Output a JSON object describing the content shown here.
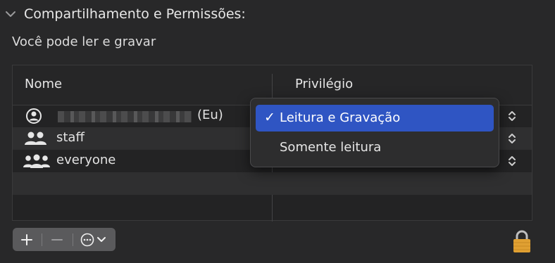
{
  "section": {
    "title": "Compartilhamento e Permissões:",
    "permission_summary": "Você pode ler e gravar"
  },
  "table": {
    "columns": {
      "name": "Nome",
      "privilege": "Privilégio"
    },
    "rows": [
      {
        "name_suffix": "(Eu)",
        "icon": "user-icon",
        "name_redacted": true
      },
      {
        "name": "staff",
        "icon": "group-icon"
      },
      {
        "name": "everyone",
        "icon": "everyone-icon"
      }
    ]
  },
  "privilege_menu": {
    "options": [
      {
        "label": "Leitura e Gravação",
        "checked": true
      },
      {
        "label": "Somente leitura",
        "checked": false
      }
    ],
    "check_glyph": "✓"
  },
  "toolbar": {
    "add_icon": "plus-icon",
    "remove_icon": "minus-icon",
    "actions_icon": "ellipsis-circle-icon"
  },
  "lock": {
    "icon": "lock-icon",
    "state": "unlocked"
  },
  "colors": {
    "accent": "#2f55c3",
    "background": "#282829",
    "lock": "#e0a032"
  }
}
